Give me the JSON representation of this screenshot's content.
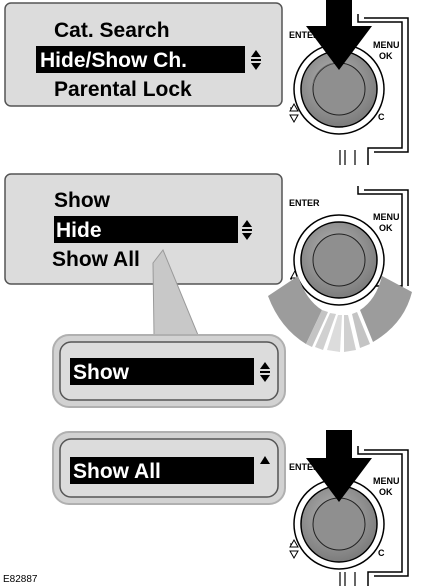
{
  "panel1": {
    "items": [
      "Cat. Search",
      "Hide/Show Ch.",
      "Parental Lock"
    ],
    "selected_index": 1
  },
  "panel2": {
    "items": [
      "Show",
      "Hide",
      "Show All"
    ],
    "selected_index": 1
  },
  "popup1": {
    "label": "Show"
  },
  "popup2": {
    "label": "Show All"
  },
  "controller": {
    "enter_label": "ENTER",
    "menu_label": "MENU",
    "ok_label": "OK",
    "c_label": "C"
  },
  "figure_code": "E82887",
  "colors": {
    "lcd_bg": "#dcdcdc",
    "lcd_border": "#555555",
    "selection_bg": "#000000",
    "dial_fill": "#8a8a8a",
    "rotate_arrow": "#aaaaaa"
  },
  "icons": [
    "up-down-arrow-icon",
    "up-arrow-icon",
    "press-arrow-icon",
    "rotate-arrows-icon"
  ]
}
